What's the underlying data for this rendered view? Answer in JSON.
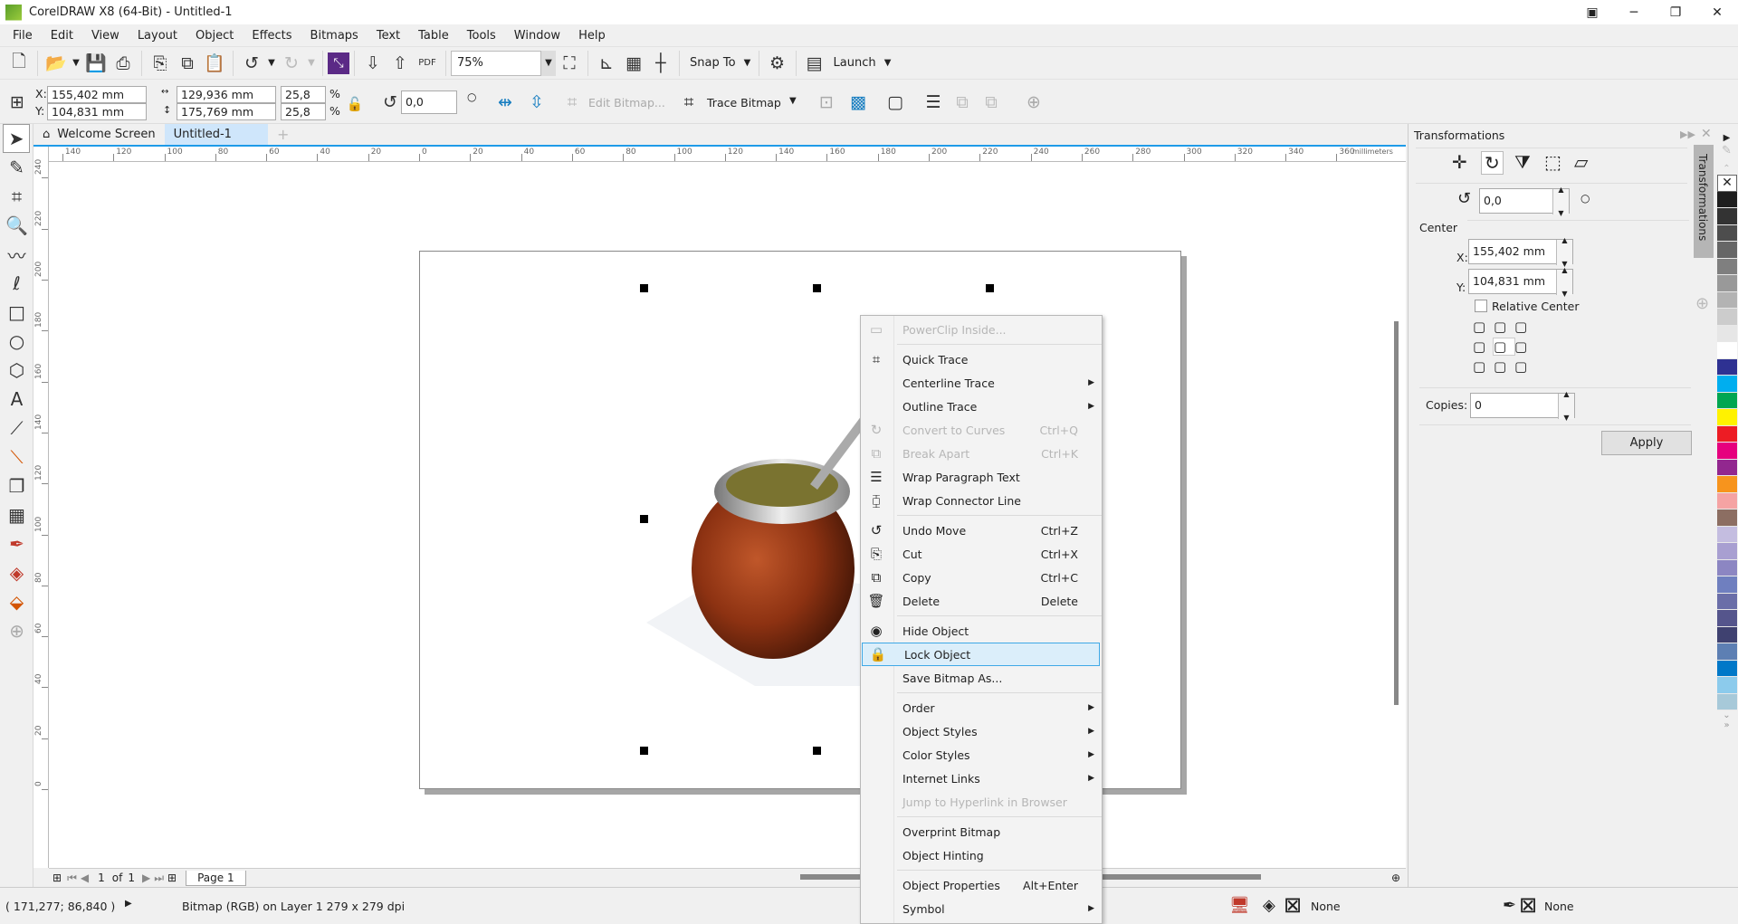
{
  "window": {
    "title": "CorelDRAW X8 (64-Bit) - Untitled-1"
  },
  "menubar": [
    "File",
    "Edit",
    "View",
    "Layout",
    "Object",
    "Effects",
    "Bitmaps",
    "Text",
    "Table",
    "Tools",
    "Window",
    "Help"
  ],
  "toolbar": {
    "zoom_level": "75%",
    "snap_to": "Snap To",
    "launch": "Launch",
    "pdf": "PDF"
  },
  "propertybar": {
    "x": "155,402 mm",
    "y": "104,831 mm",
    "width": "129,936 mm",
    "height": "175,769 mm",
    "scale_x": "25,8",
    "scale_y": "25,8",
    "percent": "%",
    "x_label": "X:",
    "y_label": "Y:",
    "rotation": "0,0",
    "edit_bitmap": "Edit Bitmap...",
    "trace_bitmap": "Trace Bitmap"
  },
  "tabs": [
    {
      "label": "Welcome Screen"
    },
    {
      "label": "Untitled-1",
      "active": true
    }
  ],
  "ruler": {
    "unit": "millimeters",
    "top_labels": [
      "140",
      "120",
      "100",
      "80",
      "60",
      "40",
      "20",
      "0",
      "20",
      "40",
      "60",
      "80",
      "100",
      "120",
      "140",
      "160",
      "180",
      "200",
      "220",
      "240",
      "260",
      "280",
      "300",
      "320",
      "340",
      "360"
    ],
    "left_labels": [
      "240",
      "220",
      "200",
      "180",
      "160",
      "140",
      "120",
      "100",
      "80",
      "60",
      "40",
      "20",
      "0"
    ]
  },
  "pagenav": {
    "current": "1",
    "of": "of",
    "total": "1",
    "page_tab": "Page 1"
  },
  "statusbar": {
    "coords": "( 171,277; 86,840 )",
    "info": "Bitmap (RGB) on Layer 1 279 x 279 dpi",
    "fill": "None",
    "outline": "None"
  },
  "docker": {
    "title": "Transformations",
    "tab_label": "Transformations",
    "rotation": "0,0",
    "center_label": "Center",
    "x_label": "X:",
    "x": "155,402 mm",
    "y_label": "Y:",
    "y": "104,831 mm",
    "relative_center": "Relative Center",
    "relative_center_checked": false,
    "copies_label": "Copies:",
    "copies": "0",
    "apply": "Apply"
  },
  "palette": [
    "none",
    "#1e1e1e",
    "#333333",
    "#4d4d4d",
    "#666666",
    "#7f7f7f",
    "#999999",
    "#b3b3b3",
    "#cccccc",
    "#e6e6e6",
    "#ffffff",
    "#2e3192",
    "#00aeef",
    "#00a651",
    "#fff200",
    "#ed1c24",
    "#e6007e",
    "#92278f",
    "#f7941d",
    "#f5a3a3",
    "#8c6e62",
    "#c4bde0",
    "#a89fd1",
    "#8c86c2",
    "#6f7fbf",
    "#6a6ea8",
    "#55558c",
    "#3f4170",
    "#5d7fb3",
    "#0078c8",
    "#8ccbec",
    "#a7c9d9"
  ],
  "context_menu": [
    {
      "label": "PowerClip Inside...",
      "icon": "powerclip-icon",
      "glyph": "▭",
      "disabled": true
    },
    {
      "sep": true
    },
    {
      "label": "Quick Trace",
      "icon": "quick-trace-icon",
      "glyph": "⌗"
    },
    {
      "label": "Centerline Trace",
      "submenu": true
    },
    {
      "label": "Outline Trace",
      "submenu": true
    },
    {
      "label": "Convert to Curves",
      "shortcut": "Ctrl+Q",
      "icon": "convert-curves-icon",
      "glyph": "↻",
      "disabled": true
    },
    {
      "label": "Break Apart",
      "shortcut": "Ctrl+K",
      "icon": "break-apart-icon",
      "glyph": "⧉",
      "disabled": true
    },
    {
      "label": "Wrap Paragraph Text",
      "icon": "wrap-text-icon",
      "glyph": "☰"
    },
    {
      "label": "Wrap Connector Line",
      "icon": "wrap-connector-icon",
      "glyph": "⧮"
    },
    {
      "sep": true
    },
    {
      "label": "Undo Move",
      "shortcut": "Ctrl+Z",
      "icon": "undo-icon",
      "glyph": "↺"
    },
    {
      "label": "Cut",
      "shortcut": "Ctrl+X",
      "icon": "cut-icon",
      "glyph": "⎘"
    },
    {
      "label": "Copy",
      "shortcut": "Ctrl+C",
      "icon": "copy-icon",
      "glyph": "⧉"
    },
    {
      "label": "Delete",
      "shortcut": "Delete",
      "icon": "trash-icon",
      "glyph": "🗑"
    },
    {
      "sep": true
    },
    {
      "label": "Hide Object",
      "icon": "hide-eye-icon",
      "glyph": "◉"
    },
    {
      "label": "Lock Object",
      "icon": "lock-icon",
      "glyph": "🔒",
      "highlighted": true
    },
    {
      "label": "Save Bitmap As..."
    },
    {
      "sep": true
    },
    {
      "label": "Order",
      "submenu": true
    },
    {
      "label": "Object Styles",
      "submenu": true
    },
    {
      "label": "Color Styles",
      "submenu": true
    },
    {
      "label": "Internet Links",
      "submenu": true
    },
    {
      "label": "Jump to Hyperlink in Browser",
      "disabled": true
    },
    {
      "sep": true
    },
    {
      "label": "Overprint Bitmap"
    },
    {
      "label": "Object Hinting"
    },
    {
      "sep": true
    },
    {
      "label": "Object Properties",
      "shortcut": "Alt+Enter"
    },
    {
      "label": "Symbol",
      "submenu": true
    }
  ]
}
